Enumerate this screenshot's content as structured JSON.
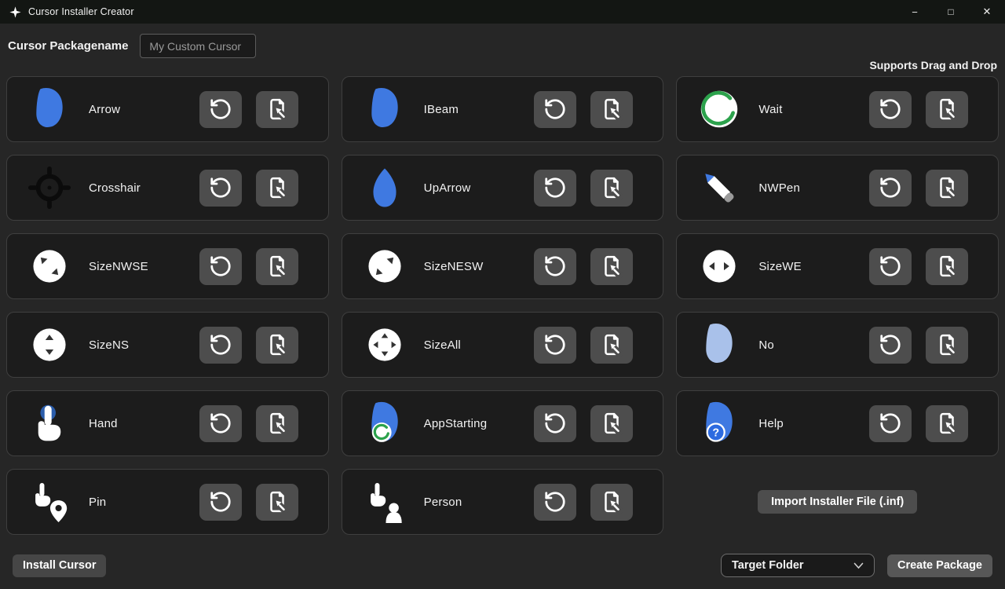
{
  "window": {
    "title": "Cursor Installer Creator",
    "minimize_glyph": "−",
    "maximize_glyph": "□",
    "close_glyph": "✕"
  },
  "header": {
    "packagename_label": "Cursor Packagename",
    "packagename_value": "My Custom Cursor",
    "drag_drop_hint": "Supports Drag and Drop"
  },
  "cursors": [
    {
      "name": "Arrow",
      "icon": "arrow"
    },
    {
      "name": "IBeam",
      "icon": "ibeam"
    },
    {
      "name": "Wait",
      "icon": "wait"
    },
    {
      "name": "Crosshair",
      "icon": "crosshair"
    },
    {
      "name": "UpArrow",
      "icon": "uparrow"
    },
    {
      "name": "NWPen",
      "icon": "nwpen"
    },
    {
      "name": "SizeNWSE",
      "icon": "sizenwse"
    },
    {
      "name": "SizeNESW",
      "icon": "sizenesw"
    },
    {
      "name": "SizeWE",
      "icon": "sizewe"
    },
    {
      "name": "SizeNS",
      "icon": "sizens"
    },
    {
      "name": "SizeAll",
      "icon": "sizeall"
    },
    {
      "name": "No",
      "icon": "no"
    },
    {
      "name": "Hand",
      "icon": "hand"
    },
    {
      "name": "AppStarting",
      "icon": "appstarting"
    },
    {
      "name": "Help",
      "icon": "help"
    },
    {
      "name": "Pin",
      "icon": "pin"
    },
    {
      "name": "Person",
      "icon": "person"
    }
  ],
  "actions": {
    "import_installer": "Import Installer File (.inf)",
    "install_cursor": "Install Cursor",
    "target_folder": "Target Folder",
    "create_package": "Create Package"
  },
  "colors": {
    "titlebar-bg": "#131613",
    "app-bg": "#262626",
    "card-bg": "#1c1c1c",
    "card-border": "#3f3f3f",
    "button-bg": "#4d4d4d",
    "accent-blue": "#3f79e1",
    "pale-blue": "#a9c1ea",
    "accent-green": "#2ca24c",
    "hand-blue": "#2b5dab",
    "help-blue": "#2d6be0",
    "text": "#f2f2f2",
    "muted-text": "#9a9a9a"
  }
}
